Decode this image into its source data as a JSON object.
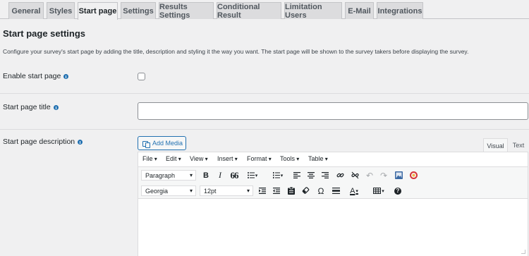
{
  "tabs": [
    {
      "label": "General"
    },
    {
      "label": "Styles"
    },
    {
      "label": "Start page"
    },
    {
      "label": "Settings"
    },
    {
      "label": "Results Settings"
    },
    {
      "label": "Conditional Result"
    },
    {
      "label": "Limitation Users"
    },
    {
      "label": "E-Mail"
    },
    {
      "label": "Integrations"
    }
  ],
  "active_tab": "Start page",
  "section": {
    "title": "Start page settings",
    "description": "Configure your survey's start page by adding the title, description and styling it the way you want. The start page will be shown to the survey takers before displaying the survey."
  },
  "fields": {
    "enable": {
      "label": "Enable start page",
      "checked": false
    },
    "title": {
      "label": "Start page title",
      "value": ""
    },
    "description": {
      "label": "Start page description"
    }
  },
  "editor": {
    "add_media_label": "Add Media",
    "mode_tabs": {
      "visual": "Visual",
      "text": "Text"
    },
    "menu": [
      "File",
      "Edit",
      "View",
      "Insert",
      "Format",
      "Tools",
      "Table"
    ],
    "format_select": "Paragraph",
    "font_select": "Georgia",
    "size_select": "12pt",
    "toolbar_row1": [
      "bold-icon",
      "italic-icon",
      "blockquote-icon",
      "bullet-list-icon",
      "numbered-list-icon",
      "align-left-icon",
      "align-center-icon",
      "align-right-icon",
      "link-icon",
      "unlink-icon",
      "undo-icon",
      "redo-icon",
      "image-icon",
      "help-ring-icon"
    ],
    "toolbar_row2": [
      "indent-icon",
      "outdent-icon",
      "paste-icon",
      "clear-format-icon",
      "omega-icon",
      "horizontal-rule-icon",
      "text-color-icon",
      "table-icon",
      "help-icon"
    ],
    "glyphs": {
      "bold": "B",
      "italic": "I",
      "quote": "66",
      "omega": "Ω",
      "help": "?",
      "textcolor": "A"
    }
  },
  "colors": {
    "accent": "#2271b1",
    "undo_disabled": "#a7aaad",
    "help_ring": "#d63638"
  }
}
